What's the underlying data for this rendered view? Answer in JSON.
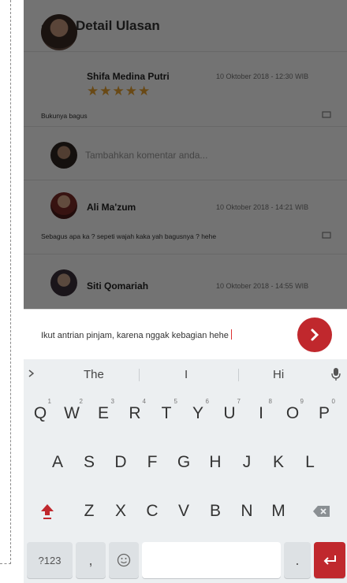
{
  "header": {
    "title": "Detail Ulasan"
  },
  "reviews": [
    {
      "name": "Shifa Medina Putri",
      "date": "10 Oktober 2018 - 12:30 WIB",
      "stars": "★★★★★",
      "text": "Bukunya bagus"
    },
    {
      "name": "Ali Ma'zum",
      "date": "10 Oktober 2018 - 14:21 WIB",
      "text": "Sebagus apa ka ? sepeti wajah kaka yah bagusnya ? hehe"
    },
    {
      "name": "Siti Qomariah",
      "date": "10 Oktober 2018 - 14:55 WIB"
    }
  ],
  "comment_input": {
    "placeholder": "Tambahkan komentar anda..."
  },
  "compose": {
    "value": "Ikut antrian pinjam, karena nggak kebagian hehe"
  },
  "keyboard": {
    "suggestions": [
      "The",
      "I",
      "Hi"
    ],
    "row1": [
      "Q",
      "W",
      "E",
      "R",
      "T",
      "Y",
      "U",
      "I",
      "O",
      "P"
    ],
    "row1_hints": [
      "1",
      "2",
      "3",
      "4",
      "5",
      "6",
      "7",
      "8",
      "9",
      "0"
    ],
    "row2": [
      "A",
      "S",
      "D",
      "F",
      "G",
      "H",
      "J",
      "K",
      "L"
    ],
    "row3": [
      "Z",
      "X",
      "C",
      "V",
      "B",
      "N",
      "M"
    ],
    "symbols_label": "?123",
    "comma": ",",
    "period": "."
  },
  "colors": {
    "accent": "#c0282d",
    "star": "#e8a230"
  }
}
